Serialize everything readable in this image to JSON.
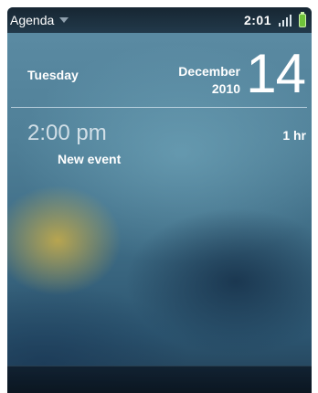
{
  "status_bar": {
    "app_name": "Agenda",
    "time": "2:01",
    "icons": [
      "chevron-down-icon",
      "signal-icon",
      "battery-icon"
    ]
  },
  "date": {
    "weekday": "Tuesday",
    "month": "December",
    "year": "2010",
    "day": "14"
  },
  "events": [
    {
      "time": "2:00 pm",
      "duration": "1 hr",
      "title": "New event"
    }
  ],
  "colors": {
    "background_top": "#5d8da5",
    "background_bottom": "#223f55",
    "battery": "#6fc23a",
    "text": "#ffffff"
  }
}
